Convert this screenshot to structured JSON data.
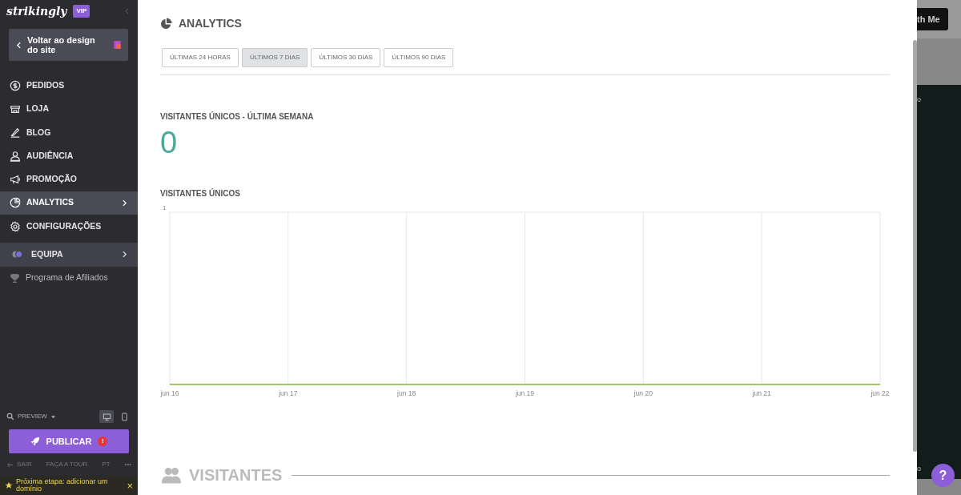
{
  "sidebar": {
    "logo": "strikingly",
    "badge": "VIP",
    "back_button": "Voltar ao design do site",
    "items": [
      {
        "label": "PEDIDOS",
        "kind": "main",
        "selected": false,
        "submenu": false
      },
      {
        "label": "LOJA",
        "kind": "main",
        "selected": false,
        "submenu": false
      },
      {
        "label": "BLOG",
        "kind": "main",
        "selected": false,
        "submenu": false
      },
      {
        "label": "AUDIÊNCIA",
        "kind": "main",
        "selected": false,
        "submenu": false
      },
      {
        "label": "PROMOÇÃO",
        "kind": "main",
        "selected": false,
        "submenu": false
      },
      {
        "label": "ANALYTICS",
        "kind": "main",
        "selected": true,
        "submenu": true
      },
      {
        "label": "CONFIGURAÇÕES",
        "kind": "main",
        "selected": false,
        "submenu": false
      },
      {
        "label": "EQUIPA",
        "kind": "team",
        "selected": false,
        "submenu": true
      },
      {
        "label": "Programa de Afiliados",
        "kind": "minor",
        "selected": false,
        "submenu": false
      }
    ],
    "preview": "PREVIEW",
    "devices": [
      {
        "kind": "desktop",
        "selected": true
      },
      {
        "kind": "mobile",
        "selected": false
      }
    ],
    "publish_button": "PUBLICAR",
    "publish_alert": "!",
    "footer": [
      "SAIR",
      "FAÇA A TOUR",
      "PT",
      "•••"
    ],
    "notice": "Próxima etapa: adicionar um domínio",
    "notice_close": "×"
  },
  "main": {
    "title": "ANALYTICS",
    "tabs": [
      {
        "label": "ÚLTIMAS 24 HORAS",
        "selected": false
      },
      {
        "label": "ÚLTIMOS 7 DIAS",
        "selected": true
      },
      {
        "label": "ÚLTIMOS 30 DIAS",
        "selected": false
      },
      {
        "label": "ÚLTIMOS 90 DIAS",
        "selected": false
      }
    ],
    "stat_label": "VISITANTES ÚNICOS - ÚLTIMA SEMANA",
    "stat_value": "0",
    "chart_title": "VISITANTES ÚNICOS",
    "chart": {
      "y_label": "1",
      "x_labels": [
        "jun 16",
        "jun 17",
        "jun 18",
        "jun 19",
        "jun 20",
        "jun 21",
        "jun 22"
      ]
    },
    "section_title": "VISITANTES"
  },
  "preview_pane": {
    "button": "th Me",
    "labels": [
      "o",
      "o"
    ],
    "help": "?"
  }
}
